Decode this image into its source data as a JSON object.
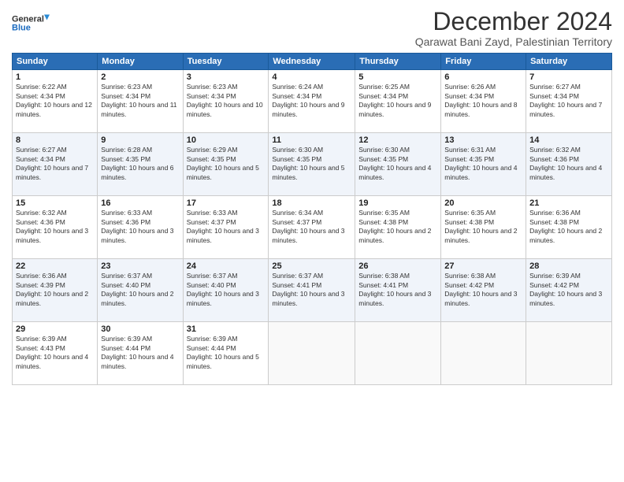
{
  "logo": {
    "line1": "General",
    "line2": "Blue"
  },
  "title": "December 2024",
  "subtitle": "Qarawat Bani Zayd, Palestinian Territory",
  "days_of_week": [
    "Sunday",
    "Monday",
    "Tuesday",
    "Wednesday",
    "Thursday",
    "Friday",
    "Saturday"
  ],
  "weeks": [
    [
      {
        "day": "1",
        "sunrise": "6:22 AM",
        "sunset": "4:34 PM",
        "daylight": "10 hours and 12 minutes."
      },
      {
        "day": "2",
        "sunrise": "6:23 AM",
        "sunset": "4:34 PM",
        "daylight": "10 hours and 11 minutes."
      },
      {
        "day": "3",
        "sunrise": "6:23 AM",
        "sunset": "4:34 PM",
        "daylight": "10 hours and 10 minutes."
      },
      {
        "day": "4",
        "sunrise": "6:24 AM",
        "sunset": "4:34 PM",
        "daylight": "10 hours and 9 minutes."
      },
      {
        "day": "5",
        "sunrise": "6:25 AM",
        "sunset": "4:34 PM",
        "daylight": "10 hours and 9 minutes."
      },
      {
        "day": "6",
        "sunrise": "6:26 AM",
        "sunset": "4:34 PM",
        "daylight": "10 hours and 8 minutes."
      },
      {
        "day": "7",
        "sunrise": "6:27 AM",
        "sunset": "4:34 PM",
        "daylight": "10 hours and 7 minutes."
      }
    ],
    [
      {
        "day": "8",
        "sunrise": "6:27 AM",
        "sunset": "4:34 PM",
        "daylight": "10 hours and 7 minutes."
      },
      {
        "day": "9",
        "sunrise": "6:28 AM",
        "sunset": "4:35 PM",
        "daylight": "10 hours and 6 minutes."
      },
      {
        "day": "10",
        "sunrise": "6:29 AM",
        "sunset": "4:35 PM",
        "daylight": "10 hours and 5 minutes."
      },
      {
        "day": "11",
        "sunrise": "6:30 AM",
        "sunset": "4:35 PM",
        "daylight": "10 hours and 5 minutes."
      },
      {
        "day": "12",
        "sunrise": "6:30 AM",
        "sunset": "4:35 PM",
        "daylight": "10 hours and 4 minutes."
      },
      {
        "day": "13",
        "sunrise": "6:31 AM",
        "sunset": "4:35 PM",
        "daylight": "10 hours and 4 minutes."
      },
      {
        "day": "14",
        "sunrise": "6:32 AM",
        "sunset": "4:36 PM",
        "daylight": "10 hours and 4 minutes."
      }
    ],
    [
      {
        "day": "15",
        "sunrise": "6:32 AM",
        "sunset": "4:36 PM",
        "daylight": "10 hours and 3 minutes."
      },
      {
        "day": "16",
        "sunrise": "6:33 AM",
        "sunset": "4:36 PM",
        "daylight": "10 hours and 3 minutes."
      },
      {
        "day": "17",
        "sunrise": "6:33 AM",
        "sunset": "4:37 PM",
        "daylight": "10 hours and 3 minutes."
      },
      {
        "day": "18",
        "sunrise": "6:34 AM",
        "sunset": "4:37 PM",
        "daylight": "10 hours and 3 minutes."
      },
      {
        "day": "19",
        "sunrise": "6:35 AM",
        "sunset": "4:38 PM",
        "daylight": "10 hours and 2 minutes."
      },
      {
        "day": "20",
        "sunrise": "6:35 AM",
        "sunset": "4:38 PM",
        "daylight": "10 hours and 2 minutes."
      },
      {
        "day": "21",
        "sunrise": "6:36 AM",
        "sunset": "4:38 PM",
        "daylight": "10 hours and 2 minutes."
      }
    ],
    [
      {
        "day": "22",
        "sunrise": "6:36 AM",
        "sunset": "4:39 PM",
        "daylight": "10 hours and 2 minutes."
      },
      {
        "day": "23",
        "sunrise": "6:37 AM",
        "sunset": "4:40 PM",
        "daylight": "10 hours and 2 minutes."
      },
      {
        "day": "24",
        "sunrise": "6:37 AM",
        "sunset": "4:40 PM",
        "daylight": "10 hours and 3 minutes."
      },
      {
        "day": "25",
        "sunrise": "6:37 AM",
        "sunset": "4:41 PM",
        "daylight": "10 hours and 3 minutes."
      },
      {
        "day": "26",
        "sunrise": "6:38 AM",
        "sunset": "4:41 PM",
        "daylight": "10 hours and 3 minutes."
      },
      {
        "day": "27",
        "sunrise": "6:38 AM",
        "sunset": "4:42 PM",
        "daylight": "10 hours and 3 minutes."
      },
      {
        "day": "28",
        "sunrise": "6:39 AM",
        "sunset": "4:42 PM",
        "daylight": "10 hours and 3 minutes."
      }
    ],
    [
      {
        "day": "29",
        "sunrise": "6:39 AM",
        "sunset": "4:43 PM",
        "daylight": "10 hours and 4 minutes."
      },
      {
        "day": "30",
        "sunrise": "6:39 AM",
        "sunset": "4:44 PM",
        "daylight": "10 hours and 4 minutes."
      },
      {
        "day": "31",
        "sunrise": "6:39 AM",
        "sunset": "4:44 PM",
        "daylight": "10 hours and 5 minutes."
      },
      null,
      null,
      null,
      null
    ]
  ],
  "labels": {
    "sunrise": "Sunrise:",
    "sunset": "Sunset:",
    "daylight": "Daylight:"
  }
}
